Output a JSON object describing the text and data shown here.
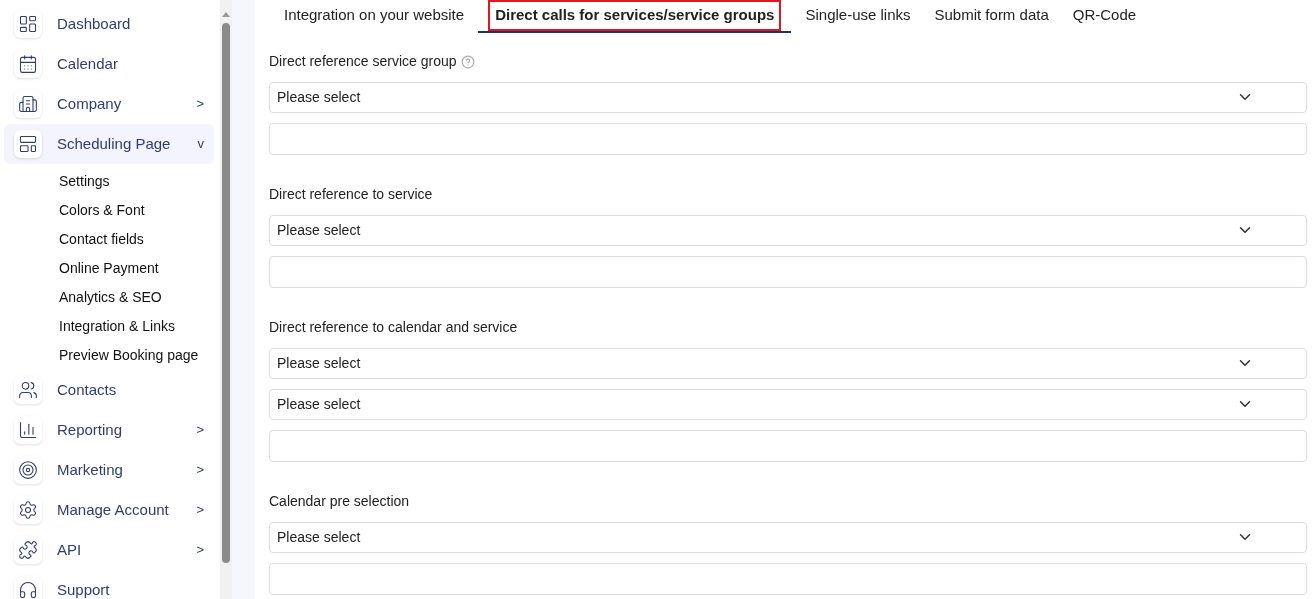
{
  "sidebar": {
    "items": [
      {
        "label": "Dashboard",
        "selected": false
      },
      {
        "label": "Calendar",
        "selected": false
      },
      {
        "label": "Company",
        "chevron": ">",
        "selected": false
      },
      {
        "label": "Scheduling Page",
        "chevron": "v",
        "selected": true,
        "children": [
          {
            "label": "Settings"
          },
          {
            "label": "Colors & Font"
          },
          {
            "label": "Contact fields"
          },
          {
            "label": "Online Payment"
          },
          {
            "label": "Analytics & SEO"
          },
          {
            "label": "Integration & Links"
          },
          {
            "label": "Preview Booking page"
          }
        ]
      },
      {
        "label": "Contacts",
        "selected": false
      },
      {
        "label": "Reporting",
        "chevron": ">",
        "selected": false
      },
      {
        "label": "Marketing",
        "chevron": ">",
        "selected": false
      },
      {
        "label": "Manage Account",
        "chevron": ">",
        "selected": false
      },
      {
        "label": "API",
        "chevron": ">",
        "selected": false
      },
      {
        "label": "Support",
        "selected": false
      }
    ]
  },
  "tabs": [
    {
      "label": "Integration on your website",
      "selected": false
    },
    {
      "label": "Direct calls for services/service groups",
      "selected": true
    },
    {
      "label": "Single-use links",
      "selected": false
    },
    {
      "label": "Submit form data",
      "selected": false
    },
    {
      "label": "QR-Code",
      "selected": false
    }
  ],
  "sections": [
    {
      "label": "Direct reference service group",
      "help": true,
      "fields": [
        {
          "kind": "select",
          "value": "Please select"
        },
        {
          "kind": "text"
        }
      ]
    },
    {
      "label": "Direct reference to service",
      "help": false,
      "fields": [
        {
          "kind": "select",
          "value": "Please select"
        },
        {
          "kind": "text"
        }
      ]
    },
    {
      "label": "Direct reference to calendar and service",
      "help": false,
      "fields": [
        {
          "kind": "select",
          "value": "Please select"
        },
        {
          "kind": "select",
          "value": "Please select"
        },
        {
          "kind": "text"
        }
      ]
    },
    {
      "label": "Calendar pre selection",
      "help": false,
      "fields": [
        {
          "kind": "select",
          "value": "Please select"
        },
        {
          "kind": "text"
        }
      ]
    }
  ]
}
